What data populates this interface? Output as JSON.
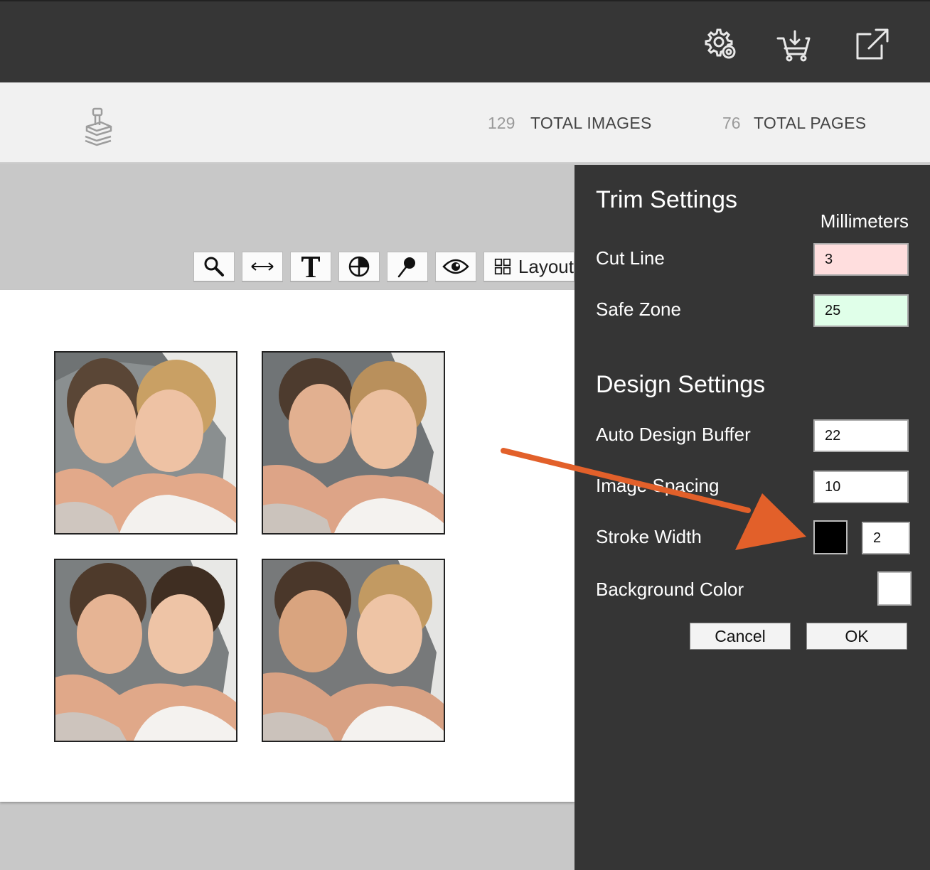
{
  "stats": {
    "images_count": "129",
    "images_label": "TOTAL IMAGES",
    "pages_count": "76",
    "pages_label": "TOTAL PAGES"
  },
  "top_icons": [
    "settings-gear-icon",
    "cart-download-icon",
    "open-external-icon"
  ],
  "toolbar": {
    "tools": [
      "zoom-icon",
      "swap-horizontal-icon",
      "text-icon",
      "color-wheel-icon",
      "pin-icon",
      "eye-icon"
    ],
    "layout_label": "Layout"
  },
  "panel": {
    "trim_title": "Trim Settings",
    "unit_label": "Millimeters",
    "cut_line_label": "Cut Line",
    "cut_line_value": "3",
    "safe_zone_label": "Safe Zone",
    "safe_zone_value": "25",
    "design_title": "Design Settings",
    "auto_buffer_label": "Auto Design Buffer",
    "auto_buffer_value": "22",
    "image_spacing_label": "Image Spacing",
    "image_spacing_value": "10",
    "stroke_width_label": "Stroke Width",
    "stroke_width_value": "2",
    "stroke_color": "#000000",
    "background_color_label": "Background Color",
    "background_color": "#ffffff",
    "cancel_label": "Cancel",
    "ok_label": "OK"
  },
  "colors": {
    "cut_line_field": "#ffdede",
    "safe_zone_field": "#e0ffe9",
    "annotation_arrow": "#e2602a"
  }
}
